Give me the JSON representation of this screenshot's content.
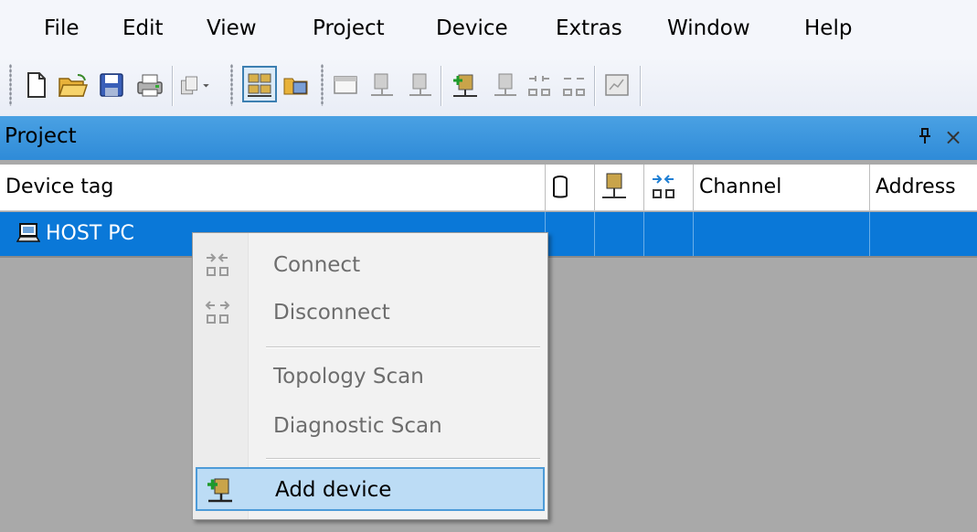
{
  "menubar": {
    "items": [
      "File",
      "Edit",
      "View",
      "Project",
      "Device",
      "Extras",
      "Window",
      "Help"
    ]
  },
  "toolbar": {
    "buttons": [
      "new-file-icon",
      "open-folder-icon",
      "save-icon",
      "print-icon",
      "copy-dropdown-icon",
      "network-view-icon",
      "catalog-icon",
      "window-icon",
      "online-device-icon",
      "offline-device-icon",
      "add-device-icon",
      "remove-device-icon",
      "connect-icon",
      "disconnect-icon",
      "monitor-icon"
    ]
  },
  "panel": {
    "title": "Project",
    "pin_glyph": "🖈",
    "close_glyph": "×"
  },
  "grid": {
    "columns": [
      "Device tag",
      "",
      "",
      "",
      "Channel",
      "Address"
    ],
    "rows": [
      {
        "device_tag": "HOST PC"
      }
    ]
  },
  "context_menu": {
    "items": [
      {
        "label": "Connect",
        "enabled": false,
        "icon": "connect-icon"
      },
      {
        "label": "Disconnect",
        "enabled": false,
        "icon": "disconnect-icon"
      },
      {
        "label": "Topology Scan",
        "enabled": false
      },
      {
        "label": "Diagnostic Scan",
        "enabled": false
      },
      {
        "label": "Add device",
        "enabled": true,
        "icon": "add-device-icon",
        "highlighted": true
      }
    ]
  },
  "colors": {
    "selection": "#0a78d8",
    "panel_header": "#3a94dc",
    "menu_highlight": "#bcdcf5"
  }
}
